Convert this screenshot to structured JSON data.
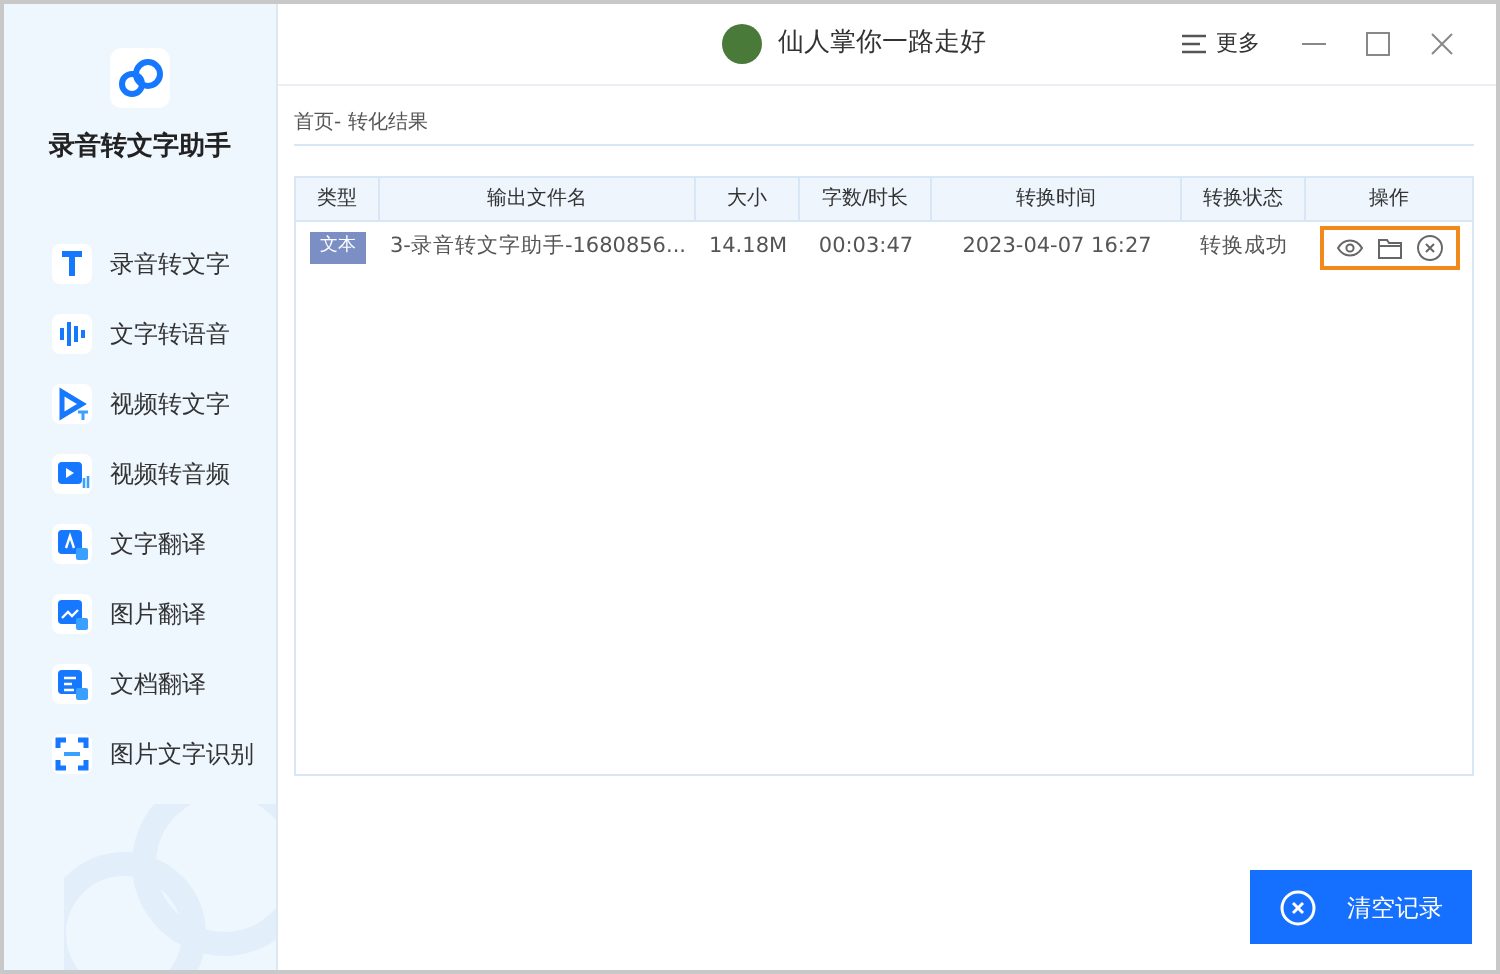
{
  "app": {
    "name": "录音转文字助手"
  },
  "sidebar": {
    "items": [
      {
        "label": "录音转文字",
        "kind": "text"
      },
      {
        "label": "文字转语音",
        "kind": "voice"
      },
      {
        "label": "视频转文字",
        "kind": "video-text"
      },
      {
        "label": "视频转音频",
        "kind": "video-audio"
      },
      {
        "label": "文字翻译",
        "kind": "translate-text"
      },
      {
        "label": "图片翻译",
        "kind": "translate-image"
      },
      {
        "label": "文档翻译",
        "kind": "translate-doc"
      },
      {
        "label": "图片文字识别",
        "kind": "ocr"
      }
    ]
  },
  "title_bar": {
    "title": "仙人掌你一路走好",
    "menu": "更多"
  },
  "breadcrumb": "首页- 转化结果",
  "table": {
    "columns": [
      "类型",
      "输出文件名",
      "大小",
      "字数/时长",
      "转换时间",
      "转换状态",
      "操作"
    ],
    "rows": [
      {
        "type": "文本",
        "filename": "3-录音转文字助手-1680856...",
        "size": "14.18M",
        "duration": "00:03:47",
        "time": "2023-04-07 16:27",
        "status": "转换成功",
        "actions_highlighted": true
      }
    ]
  },
  "clear_button": "清空记录"
}
